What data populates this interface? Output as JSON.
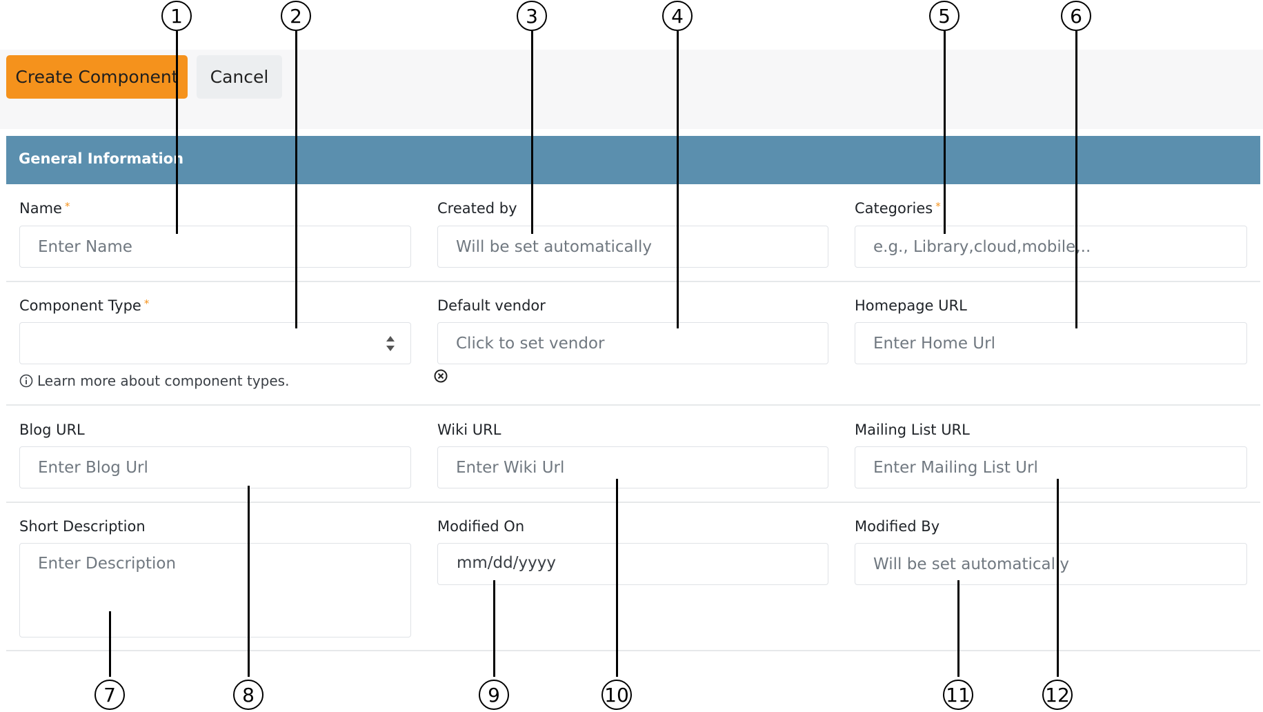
{
  "toolbar": {
    "create_label": "Create Component",
    "cancel_label": "Cancel"
  },
  "section": {
    "title": "General Information"
  },
  "fields": {
    "name": {
      "label": "Name",
      "required_mark": "*",
      "placeholder": "Enter Name"
    },
    "created_by": {
      "label": "Created by",
      "placeholder": "Will be set automatically"
    },
    "categories": {
      "label": "Categories",
      "required_mark": "*",
      "placeholder": "e.g., Library,cloud,mobile,.."
    },
    "component_type": {
      "label": "Component Type",
      "required_mark": "*",
      "value": "",
      "help": "Learn more about component types."
    },
    "default_vendor": {
      "label": "Default vendor",
      "placeholder": "Click to set vendor"
    },
    "homepage_url": {
      "label": "Homepage URL",
      "placeholder": "Enter Home Url"
    },
    "blog_url": {
      "label": "Blog URL",
      "placeholder": "Enter Blog Url"
    },
    "wiki_url": {
      "label": "Wiki URL",
      "placeholder": "Enter Wiki Url"
    },
    "mailing_list_url": {
      "label": "Mailing List URL",
      "placeholder": "Enter Mailing List Url"
    },
    "short_description": {
      "label": "Short Description",
      "placeholder": "Enter Description"
    },
    "modified_on": {
      "label": "Modified On",
      "value": "mm/dd/yyyy"
    },
    "modified_by": {
      "label": "Modified By",
      "placeholder": "Will be set automatically"
    }
  },
  "icons": {
    "select_arrows": "sort-arrows-icon",
    "info": "info-circle-icon",
    "clear": "clear-circle-icon",
    "resize": "resize-grip-icon"
  },
  "colors": {
    "primary_button": "#f5921c",
    "section_header": "#5b8fae",
    "required_mark": "#f5921c"
  },
  "callouts": [
    "1",
    "2",
    "3",
    "4",
    "5",
    "6",
    "7",
    "8",
    "9",
    "10",
    "11",
    "12"
  ]
}
